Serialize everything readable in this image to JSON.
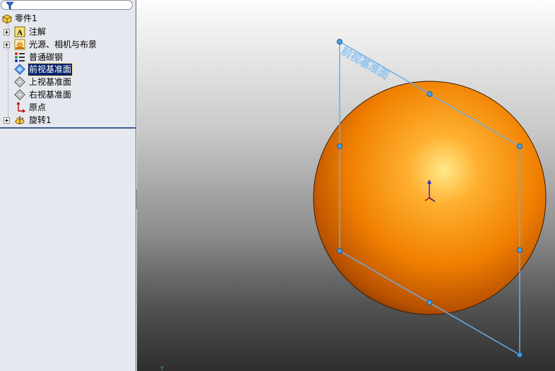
{
  "tree": {
    "filter_icon": "filter-funnel-icon",
    "root": {
      "label": "零件1",
      "icon": "part-icon"
    },
    "items": [
      {
        "label": "注解",
        "icon": "annotations-icon",
        "expandable": true,
        "selected": false
      },
      {
        "label": "光源、相机与布景",
        "icon": "lights-cameras-scene-icon",
        "expandable": true,
        "selected": false
      },
      {
        "label": "普通碳钢",
        "icon": "material-icon",
        "expandable": false,
        "selected": false
      },
      {
        "label": "前视基准面",
        "icon": "plane-icon",
        "expandable": false,
        "selected": true
      },
      {
        "label": "上视基准面",
        "icon": "plane-icon",
        "expandable": false,
        "selected": false
      },
      {
        "label": "右视基准面",
        "icon": "plane-icon",
        "expandable": false,
        "selected": false
      },
      {
        "label": "原点",
        "icon": "origin-icon",
        "expandable": false,
        "selected": false
      },
      {
        "label": "旋转1",
        "icon": "revolve-feature-icon",
        "expandable": true,
        "selected": false
      }
    ]
  },
  "viewport": {
    "plane_label": "前视基准面",
    "triad_y_label": "Y",
    "colors": {
      "sphere_light": "#ffe98a",
      "sphere_mid": "#ff9a12",
      "sphere_dark": "#7a3300",
      "plane_edge": "#6aaee8",
      "plane_label": "#8ec4f0",
      "handle": "#4aa0e0",
      "selection_bg": "#0a246a"
    }
  }
}
